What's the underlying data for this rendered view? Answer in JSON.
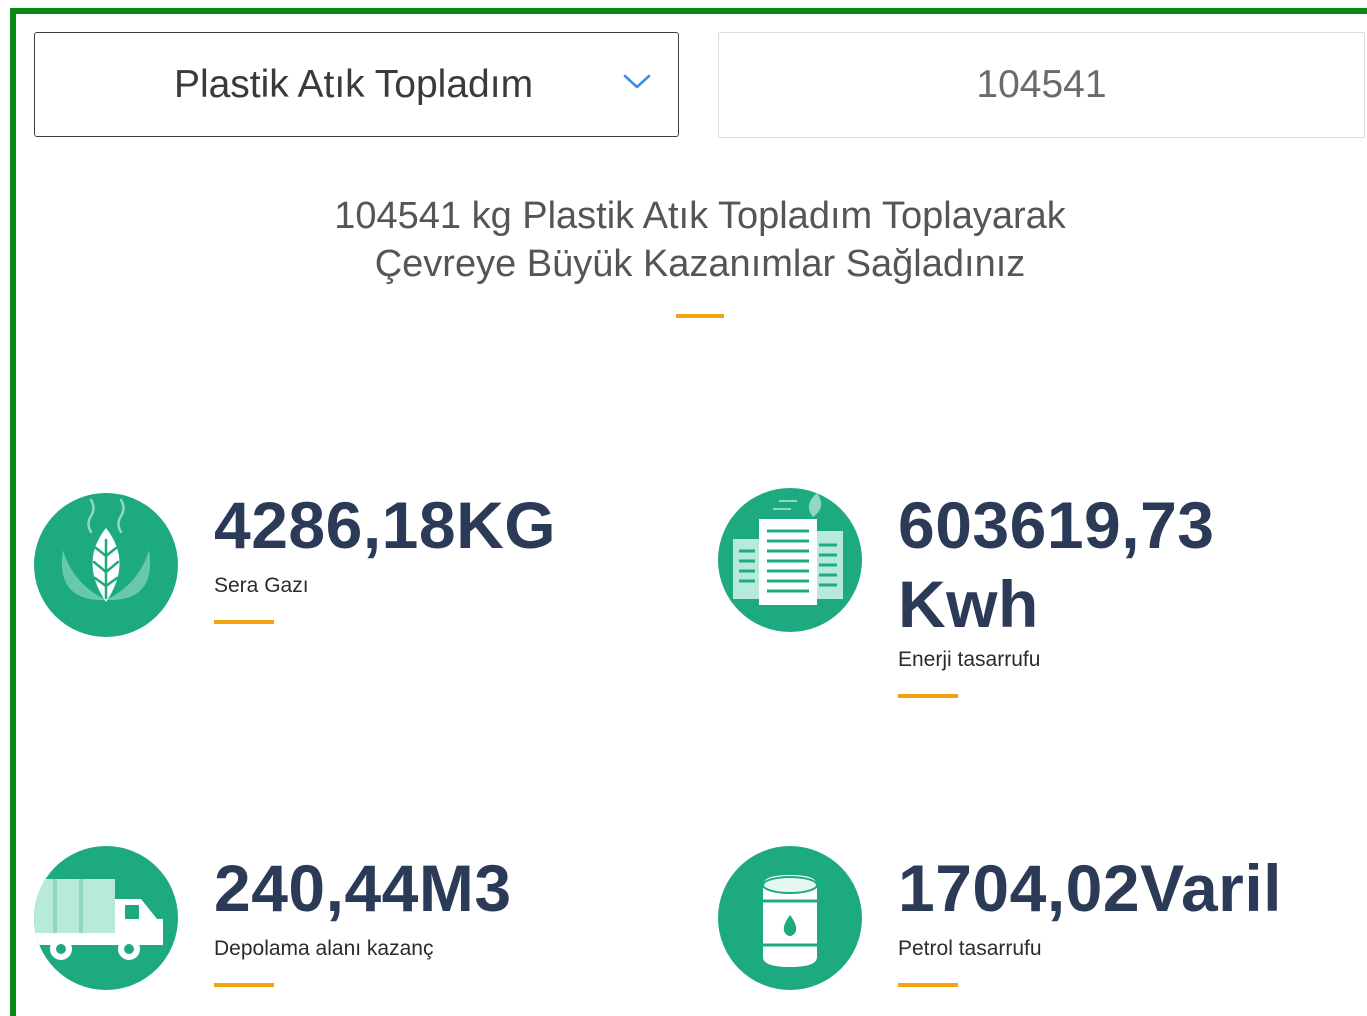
{
  "form": {
    "waste_type_selected": "Plastik Atık Topladım",
    "amount_value": "104541"
  },
  "summary": {
    "line1": "104541 kg Plastik Atık Topladım Toplayarak",
    "line2": "Çevreye Büyük Kazanımlar Sağladınız"
  },
  "stats": [
    {
      "value": "4286,18KG",
      "label": "Sera Gazı",
      "icon": "leaf-icon"
    },
    {
      "value_line1": "603619,73",
      "value_line2": "Kwh",
      "label": "Enerji tasarrufu",
      "icon": "buildings-icon"
    },
    {
      "value": "240,44M3",
      "label": "Depolama alanı kazanç",
      "icon": "truck-icon"
    },
    {
      "value": "1704,02Varil",
      "label": "Petrol tasarrufu",
      "icon": "oil-barrel-icon"
    }
  ],
  "colors": {
    "frame": "#0a8a12",
    "icon_circle": "#1eaa80",
    "value_text": "#2b3a56",
    "accent_underline": "#f2a30f",
    "chevron": "#3d8de0"
  }
}
